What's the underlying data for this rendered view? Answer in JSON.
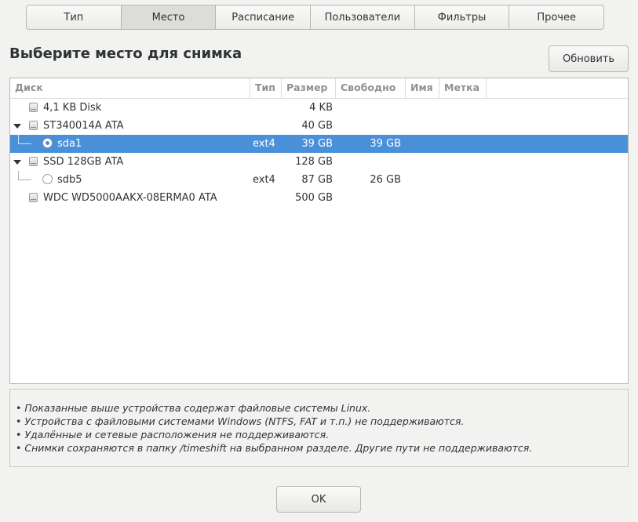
{
  "tabs": [
    {
      "label": "Тип",
      "active": false
    },
    {
      "label": "Место",
      "active": true
    },
    {
      "label": "Расписание",
      "active": false
    },
    {
      "label": "Пользователи",
      "active": false
    },
    {
      "label": "Фильтры",
      "active": false
    },
    {
      "label": "Прочее",
      "active": false
    }
  ],
  "title": "Выберите место для снимка",
  "refresh_label": "Обновить",
  "table": {
    "headers": {
      "disk": "Диск",
      "type": "Тип",
      "size": "Размер",
      "free": "Свободно",
      "name": "Имя",
      "label": "Метка"
    },
    "rows": [
      {
        "kind": "disk",
        "expanded": false,
        "name": "4,1 KB Disk",
        "type": "",
        "size": "4 KB",
        "free": "",
        "selected": false
      },
      {
        "kind": "disk",
        "expanded": true,
        "name": "ST340014A ATA",
        "type": "",
        "size": "40 GB",
        "free": "",
        "selected": false
      },
      {
        "kind": "partition",
        "name": "sda1",
        "type": "ext4",
        "size": "39 GB",
        "free": "39 GB",
        "selected": true
      },
      {
        "kind": "disk",
        "expanded": true,
        "name": "SSD 128GB ATA",
        "type": "",
        "size": "128 GB",
        "free": "",
        "selected": false
      },
      {
        "kind": "partition",
        "name": "sdb5",
        "type": "ext4",
        "size": "87 GB",
        "free": "26 GB",
        "selected": false
      },
      {
        "kind": "disk",
        "expanded": false,
        "name": "WDC WD5000AAKX-08ERMA0 ATA",
        "type": "",
        "size": "500 GB",
        "free": "",
        "selected": false
      }
    ]
  },
  "info_lines": [
    "• Показанные выше устройства содержат файловые системы Linux.",
    "• Устройства с файловыми системами Windows (NTFS, FAT и т.п.) не поддерживаются.",
    "• Удалённые и сетевые расположения не поддерживаются.",
    "• Снимки сохраняются в папку /timeshift на выбранном разделе. Другие пути не поддерживаются."
  ],
  "ok_label": "OK",
  "colors": {
    "selection": "#4a90d9",
    "background": "#f2f2f1"
  }
}
